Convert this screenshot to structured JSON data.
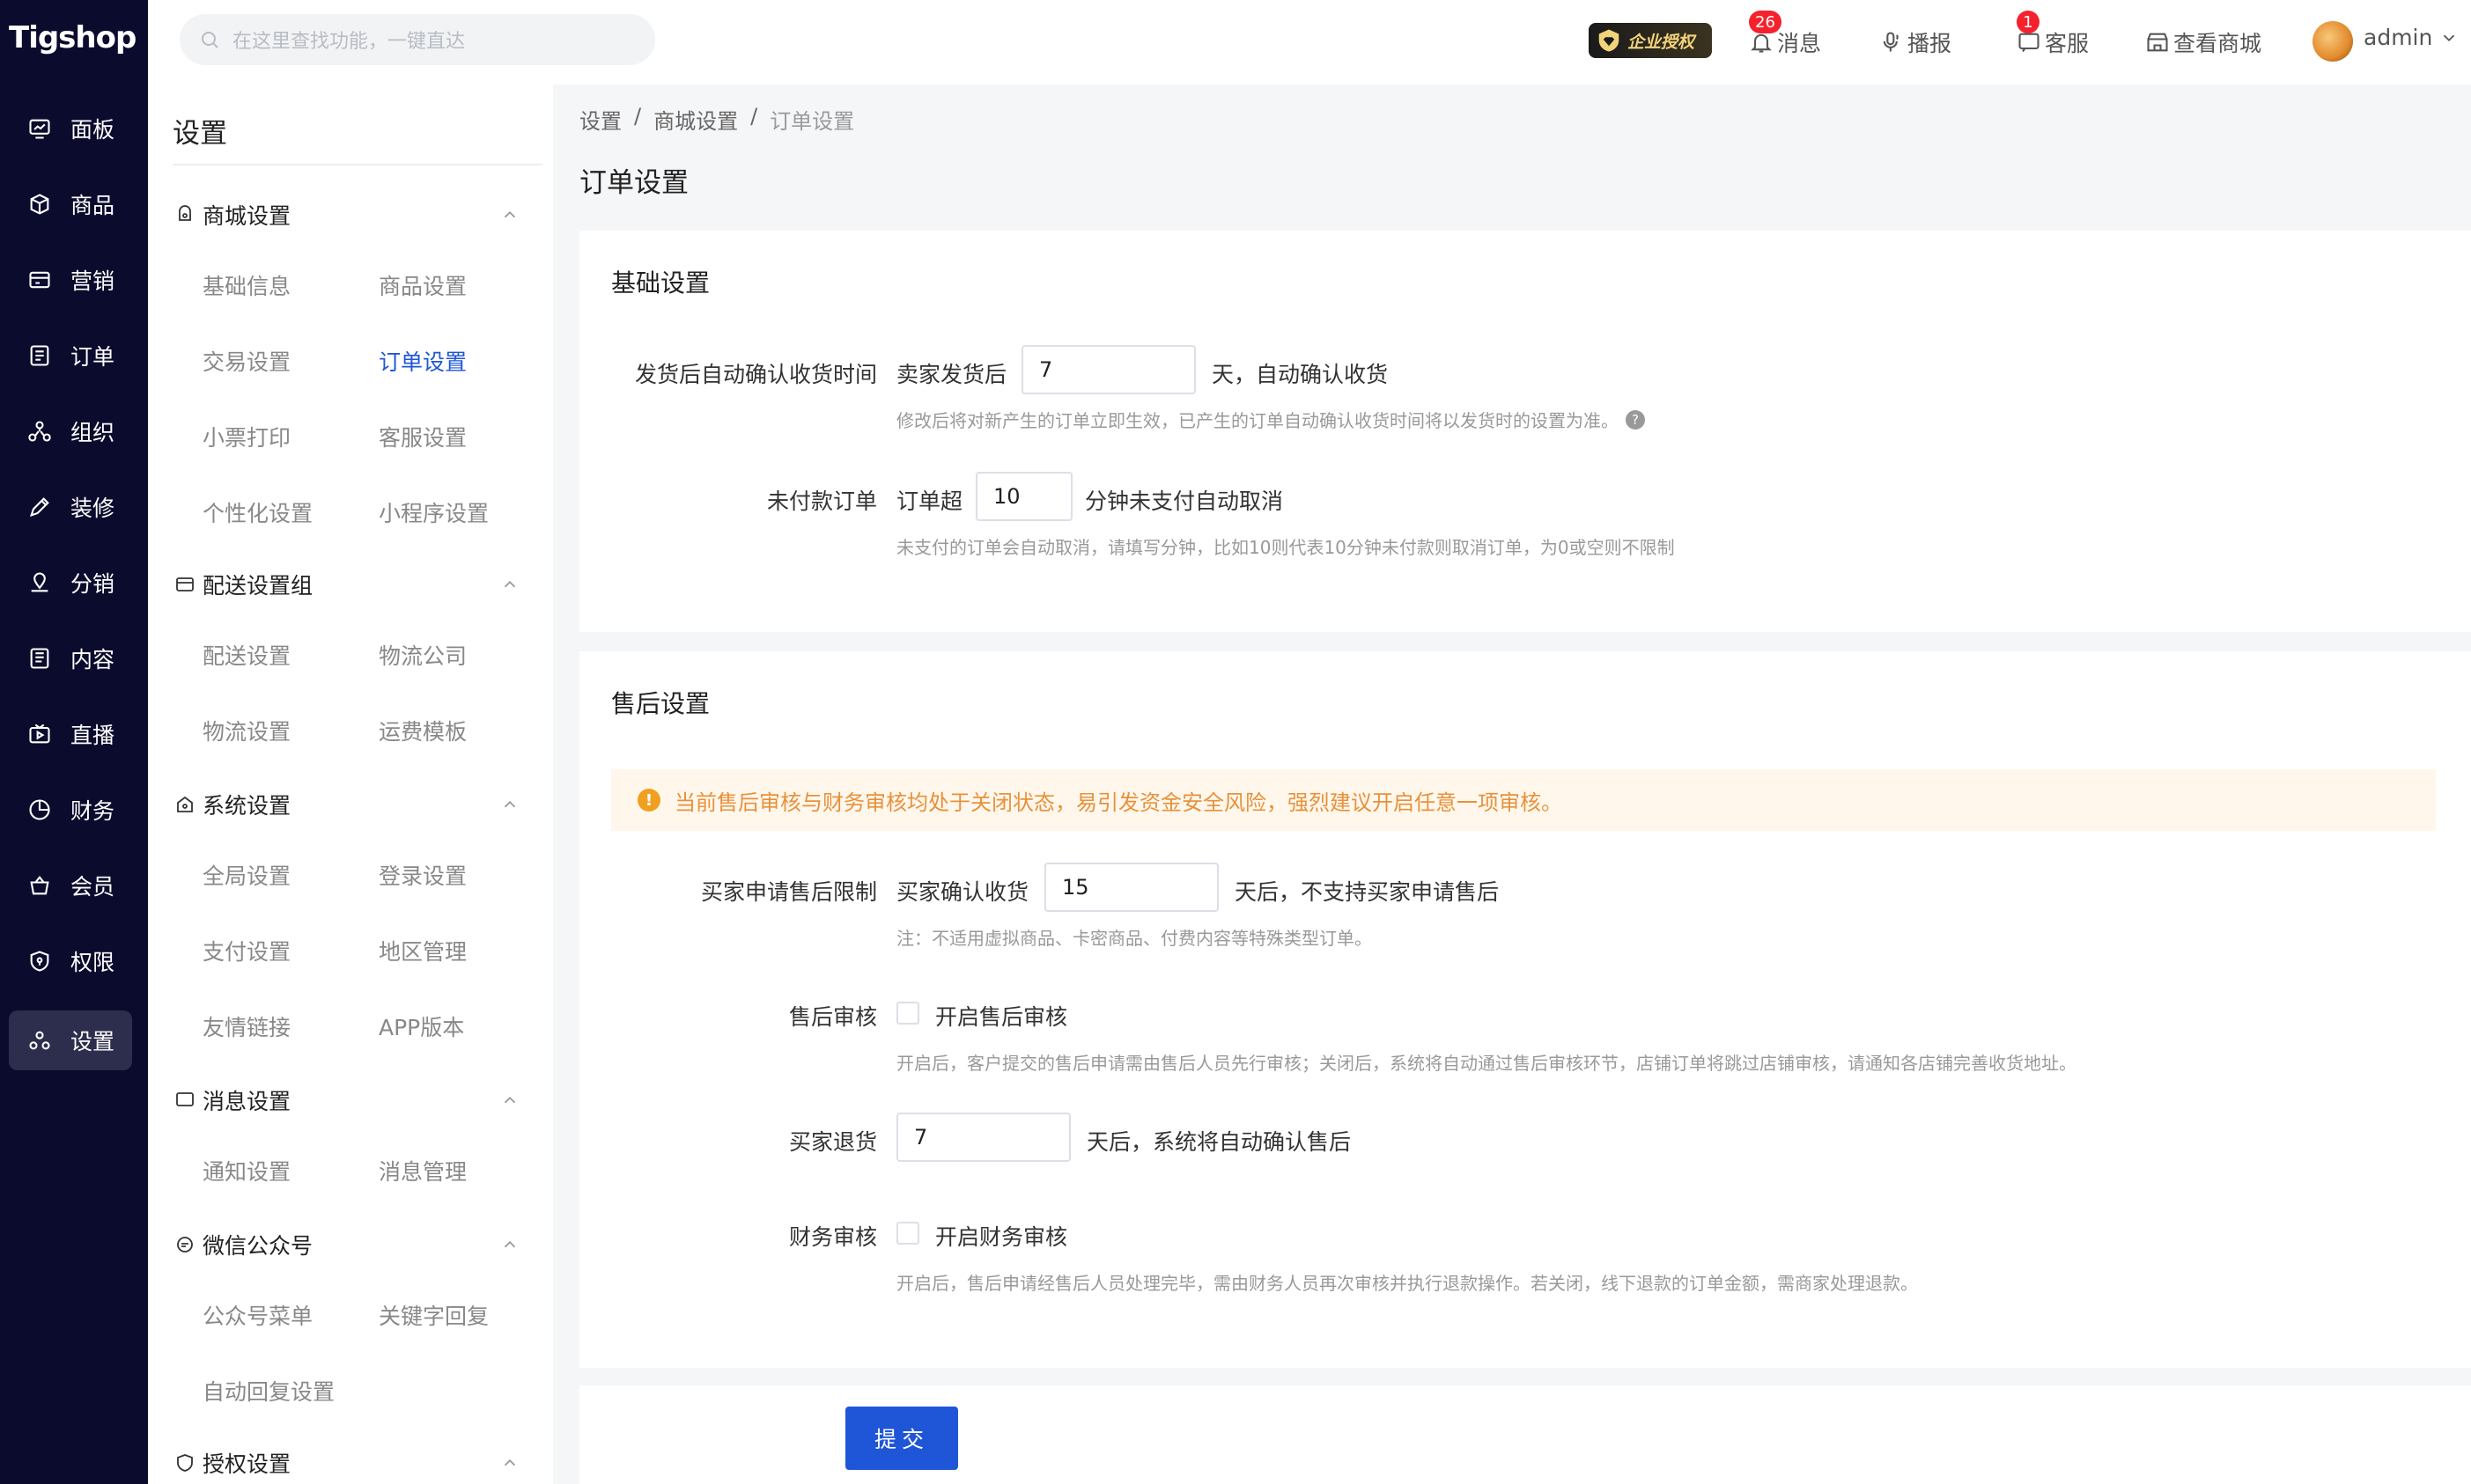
{
  "app": {
    "logo": "Tigshop"
  },
  "rail": {
    "items": [
      {
        "label": "面板",
        "icon": "dashboard-icon"
      },
      {
        "label": "商品",
        "icon": "box-icon"
      },
      {
        "label": "营销",
        "icon": "marketing-icon"
      },
      {
        "label": "订单",
        "icon": "order-icon"
      },
      {
        "label": "组织",
        "icon": "organization-icon"
      },
      {
        "label": "装修",
        "icon": "decorate-icon"
      },
      {
        "label": "分销",
        "icon": "distribution-icon"
      },
      {
        "label": "内容",
        "icon": "content-icon"
      },
      {
        "label": "直播",
        "icon": "live-icon"
      },
      {
        "label": "财务",
        "icon": "finance-icon"
      },
      {
        "label": "会员",
        "icon": "member-icon"
      },
      {
        "label": "权限",
        "icon": "permission-icon"
      },
      {
        "label": "设置",
        "icon": "settings-icon",
        "active": true
      }
    ]
  },
  "header": {
    "search_placeholder": "在这里查找功能，一键直达",
    "enterprise_badge": "企业授权",
    "messages": {
      "label": "消息",
      "count": "26"
    },
    "broadcast": {
      "label": "播报"
    },
    "service": {
      "label": "客服",
      "count": "1"
    },
    "view_store": {
      "label": "查看商城"
    },
    "user": "admin"
  },
  "subnav": {
    "title": "设置",
    "groups": [
      {
        "label": "商城设置",
        "items": [
          "基础信息",
          "商品设置",
          "交易设置",
          "订单设置",
          "小票打印",
          "客服设置",
          "个性化设置",
          "小程序设置"
        ]
      },
      {
        "label": "配送设置组",
        "items": [
          "配送设置",
          "物流公司",
          "物流设置",
          "运费模板"
        ]
      },
      {
        "label": "系统设置",
        "items": [
          "全局设置",
          "登录设置",
          "支付设置",
          "地区管理",
          "友情链接",
          "APP版本"
        ]
      },
      {
        "label": "消息设置",
        "items": [
          "通知设置",
          "消息管理"
        ]
      },
      {
        "label": "微信公众号",
        "items": [
          "公众号菜单",
          "关键字回复",
          "自动回复设置"
        ]
      },
      {
        "label": "授权设置",
        "items": []
      }
    ],
    "active_item": "订单设置"
  },
  "main": {
    "breadcrumb": [
      "设置",
      "/",
      "商城设置",
      "/",
      "订单设置"
    ],
    "title": "订单设置",
    "basic": {
      "heading": "基础设置",
      "confirm_label": "发货后自动确认收货时间",
      "confirm_prefix": "卖家发货后",
      "confirm_value": "7",
      "confirm_suffix": "天，自动确认收货",
      "confirm_hint": "修改后将对新产生的订单立即生效，已产生的订单自动确认收货时间将以发货时的设置为准。",
      "unpaid_label": "未付款订单",
      "unpaid_prefix": "订单超",
      "unpaid_value": "10",
      "unpaid_suffix": "分钟未支付自动取消",
      "unpaid_hint": "未支付的订单会自动取消，请填写分钟，比如10则代表10分钟未付款则取消订单，为0或空则不限制"
    },
    "aftersale": {
      "heading": "售后设置",
      "warning": "当前售后审核与财务审核均处于关闭状态，易引发资金安全风险，强烈建议开启任意一项审核。",
      "limit_label": "买家申请售后限制",
      "limit_prefix": "买家确认收货",
      "limit_value": "15",
      "limit_suffix": "天后，不支持买家申请售后",
      "limit_hint": "注：不适用虚拟商品、卡密商品、付费内容等特殊类型订单。",
      "audit_label": "售后审核",
      "audit_checkbox": "开启售后审核",
      "audit_checked": false,
      "audit_hint": "开启后，客户提交的售后申请需由售后人员先行审核；关闭后，系统将自动通过售后审核环节，店铺订单将跳过店铺审核，请通知各店铺完善收货地址。",
      "return_label": "买家退货",
      "return_value": "7",
      "return_suffix": "天后，系统将自动确认售后",
      "finance_label": "财务审核",
      "finance_checkbox": "开启财务审核",
      "finance_checked": false,
      "finance_hint": "开启后，售后申请经售后人员处理完毕，需由财务人员再次审核并执行退款操作。若关闭，线下退款的订单金额，需商家处理退款。"
    },
    "submit": "提交"
  },
  "colors": {
    "rail_bg": "#0b0b2e",
    "primary": "#1f56d8",
    "warning": "#e8913a"
  }
}
